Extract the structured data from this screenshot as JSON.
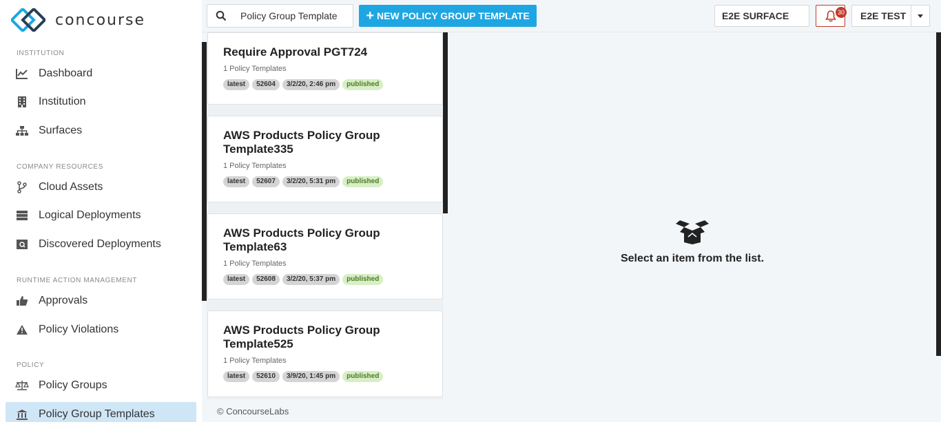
{
  "app": {
    "logo_text": "concourse"
  },
  "sidebar": {
    "sections": [
      {
        "title": "INSTITUTION",
        "items": [
          {
            "label": "Dashboard",
            "icon": "chart-line-icon"
          },
          {
            "label": "Institution",
            "icon": "building-icon"
          },
          {
            "label": "Surfaces",
            "icon": "sitemap-icon"
          }
        ]
      },
      {
        "title": "COMPANY RESOURCES",
        "items": [
          {
            "label": "Cloud Assets",
            "icon": "code-branch-icon"
          },
          {
            "label": "Logical Deployments",
            "icon": "server-icon"
          },
          {
            "label": "Discovered Deployments",
            "icon": "search-server-icon"
          }
        ]
      },
      {
        "title": "RUNTIME ACTION MANAGEMENT",
        "items": [
          {
            "label": "Approvals",
            "icon": "thumbs-up-icon"
          },
          {
            "label": "Policy Violations",
            "icon": "warning-icon"
          }
        ]
      },
      {
        "title": "POLICY",
        "items": [
          {
            "label": "Policy Groups",
            "icon": "balance-scale-icon"
          },
          {
            "label": "Policy Group Templates",
            "icon": "landmark-icon",
            "active": true
          }
        ]
      }
    ]
  },
  "topbar": {
    "search_value": "Policy Group Template",
    "new_button_label": "NEW POLICY GROUP TEMPLATE",
    "surface_label": "E2E SURFACE",
    "notification_count": "30",
    "user_label": "E2E TEST"
  },
  "list": {
    "cards": [
      {
        "title": "Require Approval PGT724",
        "subtitle": "1 Policy Templates",
        "tags": [
          "latest",
          "52604",
          "3/2/20, 2:46 pm",
          "published"
        ]
      },
      {
        "title": "AWS Products Policy Group Template335",
        "subtitle": "1 Policy Templates",
        "tags": [
          "latest",
          "52607",
          "3/2/20, 5:31 pm",
          "published"
        ]
      },
      {
        "title": "AWS Products Policy Group Template63",
        "subtitle": "1 Policy Templates",
        "tags": [
          "latest",
          "52608",
          "3/2/20, 5:37 pm",
          "published"
        ]
      },
      {
        "title": "AWS Products Policy Group Template525",
        "subtitle": "1 Policy Templates",
        "tags": [
          "latest",
          "52610",
          "3/9/20, 1:45 pm",
          "published"
        ]
      }
    ]
  },
  "empty_state": {
    "icon": "open-box-icon",
    "message": "Select an item from the list."
  },
  "footer": {
    "text": "© ConcourseLabs"
  },
  "colors": {
    "accent": "#1ea6e3",
    "alert": "#c0392b",
    "active_nav": "#cfe6f6",
    "published_tag": "#d8efc5"
  }
}
